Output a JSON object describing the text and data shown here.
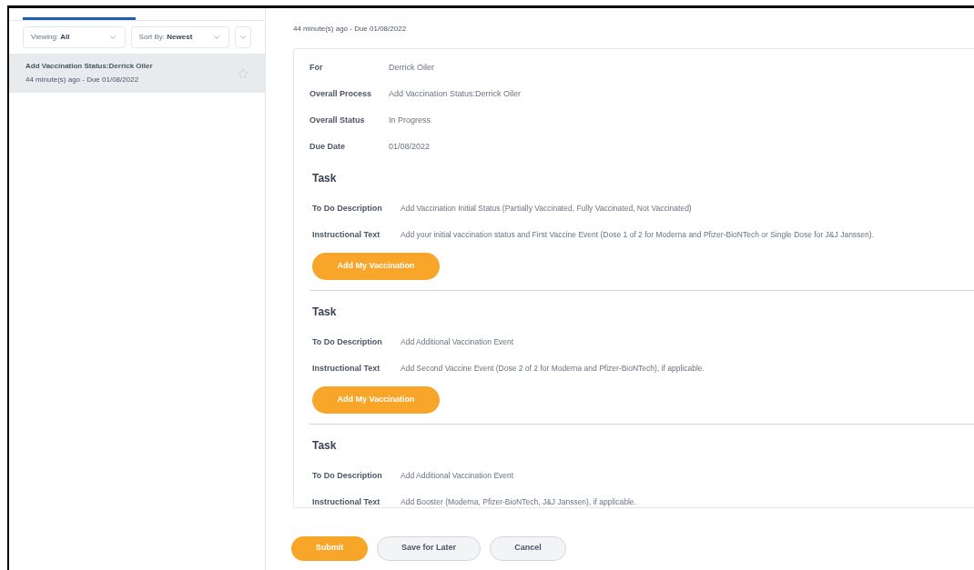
{
  "sidebar": {
    "filters": [
      {
        "label": "Viewing:",
        "value": "All"
      },
      {
        "label": "Sort By:",
        "value": "Newest"
      }
    ],
    "items": [
      {
        "title": "Add Vaccination Status:Derrick Oiler",
        "subtitle": "44 minute(s) ago - Due 01/08/2022",
        "selected": true,
        "starred": false
      }
    ]
  },
  "detail": {
    "timestamp": "44 minute(s) ago - Due 01/08/2022",
    "fields": [
      {
        "label": "For",
        "value": "Derrick Oiler"
      },
      {
        "label": "Overall Process",
        "value": "Add Vaccination Status:Derrick Oiler"
      },
      {
        "label": "Overall Status",
        "value": "In Progress"
      },
      {
        "label": "Due Date",
        "value": "01/08/2022"
      }
    ],
    "tasks": [
      {
        "heading": "Task",
        "rows": [
          {
            "label": "To Do Description",
            "value": "Add Vaccination Initial Status (Partially Vaccinated, Fully Vaccinated, Not Vaccinated)"
          },
          {
            "label": "Instructional Text",
            "value": "Add your initial vaccination status and First Vaccine Event (Dose 1 of 2 for Moderna and Pfizer-BioNTech or Single Dose for J&J Janssen)."
          }
        ],
        "button": "Add My Vaccination"
      },
      {
        "heading": "Task",
        "rows": [
          {
            "label": "To Do Description",
            "value": "Add Additional Vaccination Event"
          },
          {
            "label": "Instructional Text",
            "value": "Add Second Vaccine Event (Dose 2 of 2 for Moderna and Pfizer-BioNTech), if applicable."
          }
        ],
        "button": "Add My Vaccination"
      },
      {
        "heading": "Task",
        "rows": [
          {
            "label": "To Do Description",
            "value": "Add Additional Vaccination Event"
          },
          {
            "label": "Instructional Text",
            "value": "Add Booster (Moderna, Pfizer-BioNTech, J&J Janssen), if applicable."
          }
        ]
      }
    ]
  },
  "footer": {
    "buttons": [
      {
        "label": "Submit",
        "kind": "primary"
      },
      {
        "label": "Save for Later",
        "kind": "secondary"
      },
      {
        "label": "Cancel",
        "kind": "secondary"
      }
    ]
  }
}
